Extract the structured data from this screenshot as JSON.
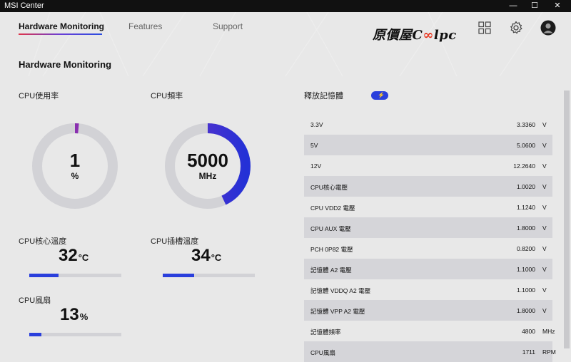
{
  "window": {
    "title": "MSI Center",
    "minimize": "—",
    "maximize": "☐",
    "close": "✕"
  },
  "nav": {
    "tab1": "Hardware Monitoring",
    "tab2": "Features",
    "tab3": "Support"
  },
  "logo": {
    "text1": "原價屋C",
    "text2": "lpc"
  },
  "page": {
    "title": "Hardware Monitoring"
  },
  "cpu_usage": {
    "label": "CPU使用率",
    "value": "1",
    "unit": "%",
    "fraction": 0.01
  },
  "cpu_freq": {
    "label": "CPU頻率",
    "value": "5000",
    "unit": "MHz",
    "fraction": 0.43
  },
  "cpu_core_temp": {
    "label": "CPU核心溫度",
    "value": "32",
    "unit": "°C",
    "fraction": 0.32
  },
  "cpu_socket_temp": {
    "label": "CPU插槽溫度",
    "value": "34",
    "unit": "°C",
    "fraction": 0.34
  },
  "cpu_fan": {
    "label": "CPU風扇",
    "value": "13",
    "unit": "%",
    "fraction": 0.13
  },
  "memory_release": {
    "label": "釋放記憶體"
  },
  "voltages": [
    {
      "name": "3.3V",
      "value": "3.3360",
      "unit": "V"
    },
    {
      "name": "5V",
      "value": "5.0600",
      "unit": "V"
    },
    {
      "name": "12V",
      "value": "12.2640",
      "unit": "V"
    },
    {
      "name": "CPU核心電壓",
      "value": "1.0020",
      "unit": "V"
    },
    {
      "name": "CPU VDD2 電壓",
      "value": "1.1240",
      "unit": "V"
    },
    {
      "name": "CPU AUX 電壓",
      "value": "1.8000",
      "unit": "V"
    },
    {
      "name": "PCH 0P82 電壓",
      "value": "0.8200",
      "unit": "V"
    },
    {
      "name": "記憶體 A2 電壓",
      "value": "1.1000",
      "unit": "V"
    },
    {
      "name": "記憶體 VDDQ A2 電壓",
      "value": "1.1000",
      "unit": "V"
    },
    {
      "name": "記憶體 VPP A2 電壓",
      "value": "1.8000",
      "unit": "V"
    },
    {
      "name": "記憶體頻率",
      "value": "4800",
      "unit": "MHz"
    },
    {
      "name": "CPU風扇",
      "value": "1711",
      "unit": "RPM"
    }
  ],
  "colors": {
    "accent": "#2a3fdc",
    "purple": "#8a2fb0",
    "track": "#d2d2d6"
  }
}
